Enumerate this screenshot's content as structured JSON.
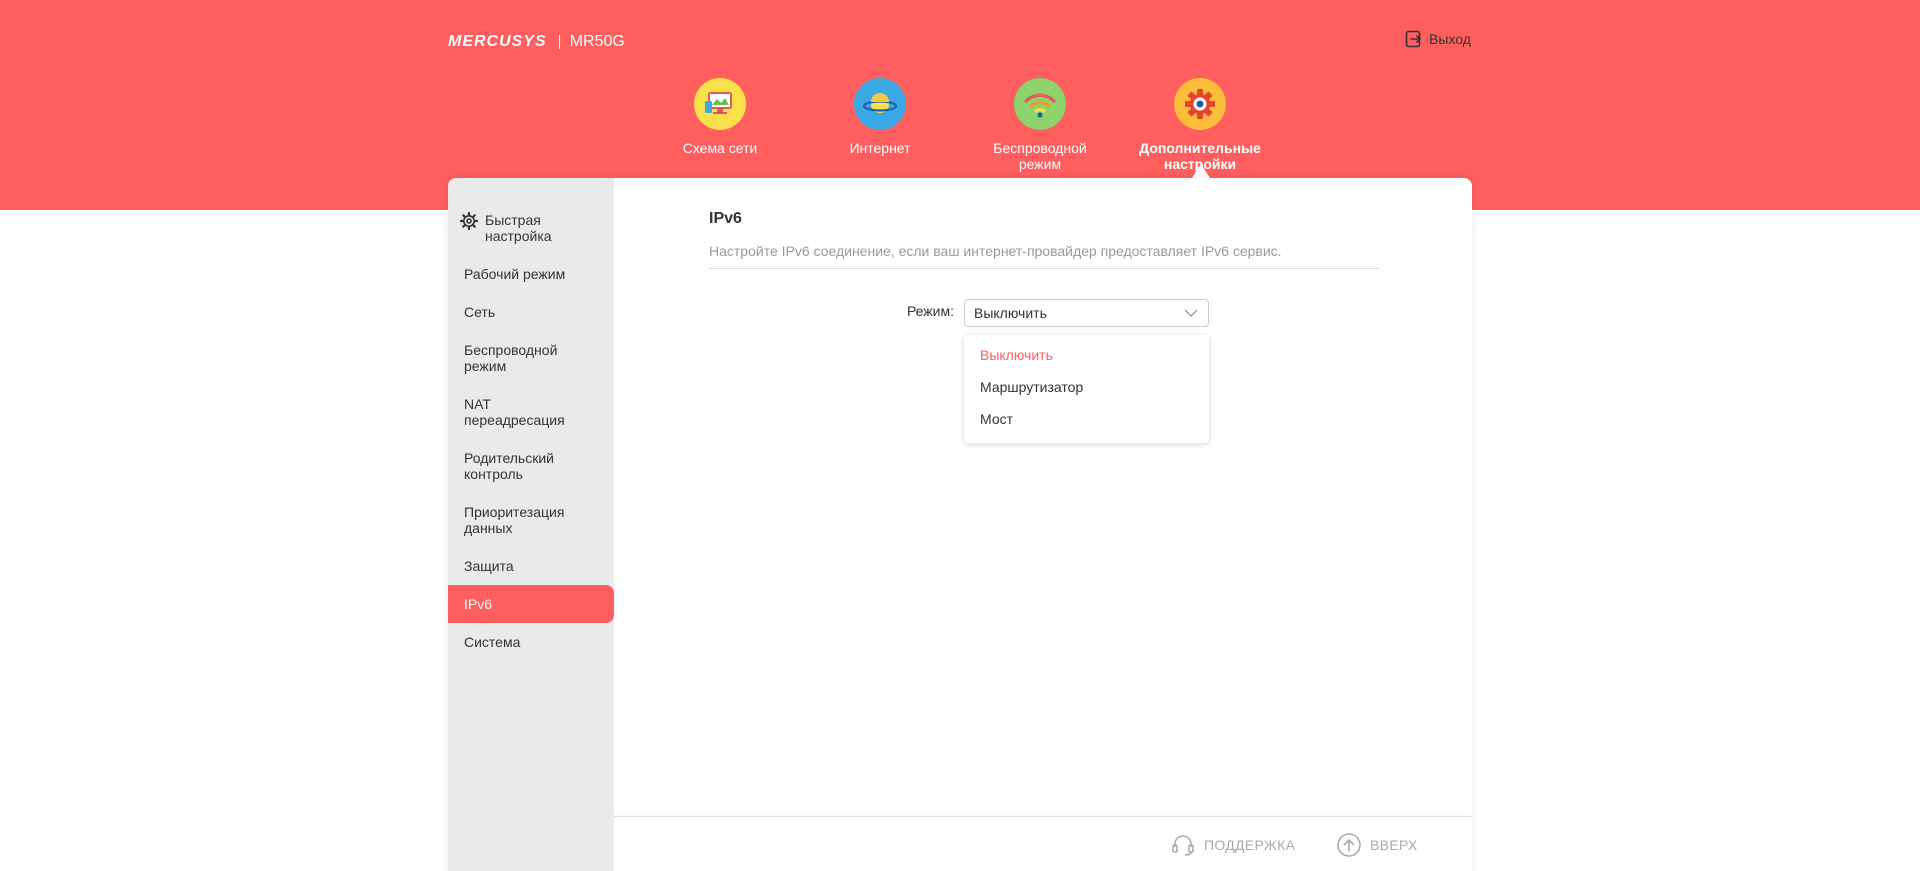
{
  "header": {
    "brand": "MERCUSYS",
    "model": "MR50G",
    "logout_label": "Выход"
  },
  "nav": {
    "items": [
      {
        "label": "Схема сети",
        "icon": "network-map-icon",
        "color": "#f9e14b"
      },
      {
        "label": "Интернет",
        "icon": "globe-planet-icon",
        "color": "#3aa9e6"
      },
      {
        "label": "Беспроводной режим",
        "icon": "wifi-icon",
        "color": "#8dd26b"
      },
      {
        "label": "Дополнительные настройки",
        "icon": "gear-icon",
        "color": "#fbbd3b"
      }
    ],
    "active_index": 3
  },
  "sidebar": {
    "items": [
      {
        "label": "Быстрая настройка"
      },
      {
        "label": "Рабочий режим"
      },
      {
        "label": "Сеть"
      },
      {
        "label": "Беспроводной режим"
      },
      {
        "label": "NAT переадресация"
      },
      {
        "label": "Родительский контроль"
      },
      {
        "label": "Приоритезация данных"
      },
      {
        "label": "Защита"
      },
      {
        "label": "IPv6"
      },
      {
        "label": "Система"
      }
    ],
    "active_index": 8
  },
  "content": {
    "title": "IPv6",
    "description": "Настройте IPv6 соединение, если ваш интернет-провайдер предоставляет IPv6 сервис.",
    "mode_label": "Режим:",
    "mode_value": "Выключить",
    "mode_options": [
      "Выключить",
      "Маршрутизатор",
      "Мост"
    ]
  },
  "footer": {
    "support_label": "ПОДДЕРЖКА",
    "top_label": "ВВЕРХ"
  },
  "colors": {
    "accent": "#ff5e5e",
    "sidebar_bg": "#e9eaeb"
  }
}
